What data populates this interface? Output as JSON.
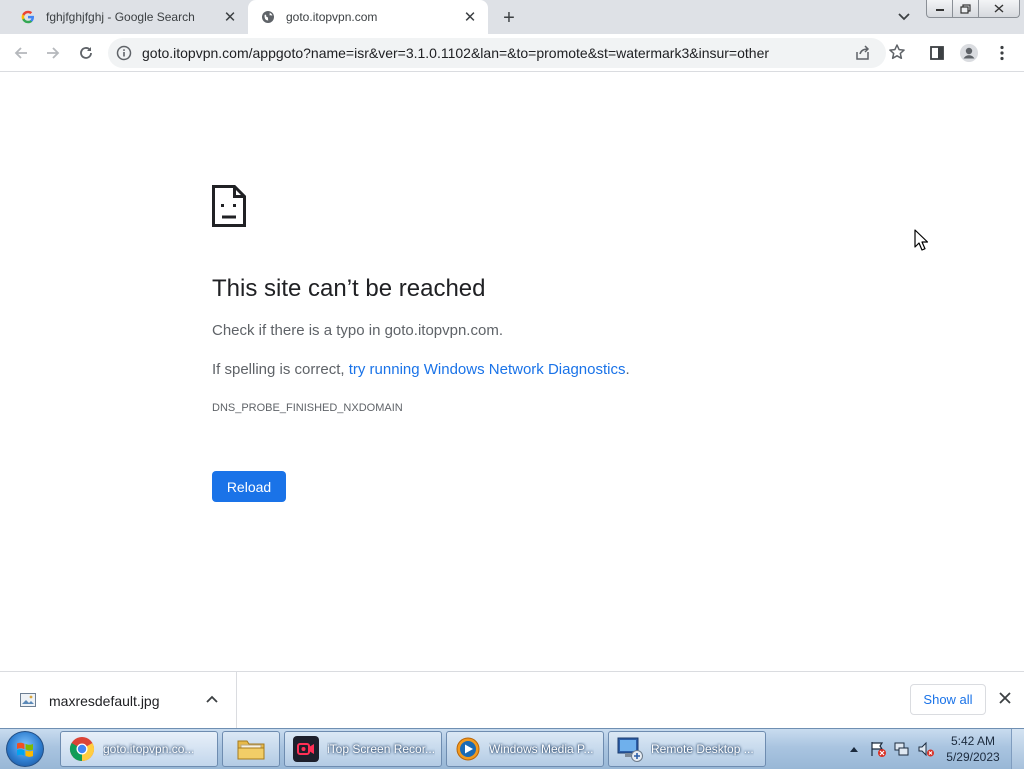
{
  "tabs": [
    {
      "title": "fghjfghjfghj - Google Search",
      "favicon": "google-icon",
      "active": false
    },
    {
      "title": "goto.itopvpn.com",
      "favicon": "globe-icon",
      "active": true
    }
  ],
  "toolbar": {
    "url": "goto.itopvpn.com/appgoto?name=isr&ver=3.1.0.1102&lan=&to=promote&st=watermark3&insur=other"
  },
  "error_page": {
    "heading": "This site can’t be reached",
    "typo_text": "Check if there is a typo in goto.itopvpn.com.",
    "spelling_prefix": "If spelling is correct, ",
    "diagnostics_link": "try running Windows Network Diagnostics",
    "spelling_suffix": ".",
    "error_code": "DNS_PROBE_FINISHED_NXDOMAIN",
    "reload_label": "Reload"
  },
  "download_shelf": {
    "filename": "maxresdefault.jpg",
    "show_all_label": "Show all"
  },
  "taskbar": {
    "items": [
      {
        "label": "goto.itopvpn.co...",
        "icon": "chrome-icon"
      },
      {
        "label": "",
        "icon": "folder-icon"
      },
      {
        "label": "iTop Screen Recor...",
        "icon": "recorder-icon"
      },
      {
        "label": "Windows Media P...",
        "icon": "media-player-icon"
      },
      {
        "label": "Remote Desktop ...",
        "icon": "remote-desktop-icon"
      }
    ],
    "clock_time": "5:42 AM",
    "clock_date": "5/29/2023"
  },
  "colors": {
    "accent": "#1a73e8",
    "tabstrip": "#dee1e6",
    "text": "#202124",
    "secondary_text": "#5f6368"
  }
}
